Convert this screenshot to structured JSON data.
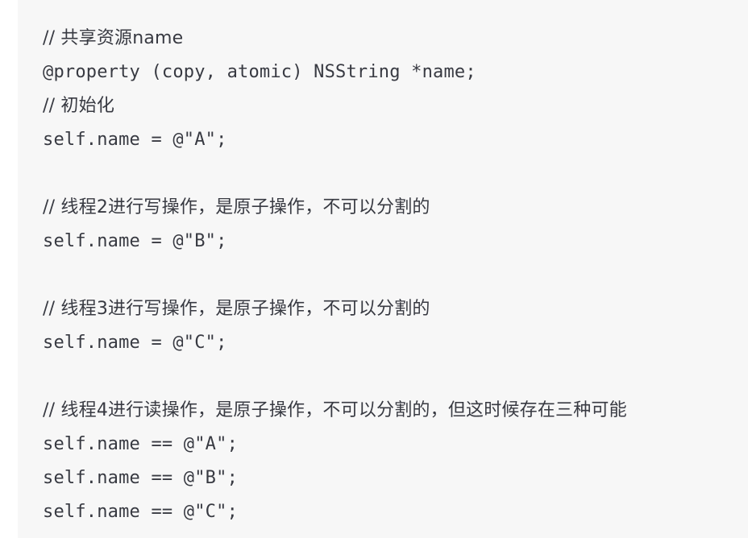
{
  "code": {
    "lines": [
      "// 共享资源name",
      "@property (copy, atomic) NSString *name;",
      "// 初始化",
      "self.name = @\"A\";",
      "",
      "// 线程2进行写操作，是原子操作，不可以分割的",
      "self.name = @\"B\";",
      "",
      "// 线程3进行写操作，是原子操作，不可以分割的",
      "self.name = @\"C\";",
      "",
      "// 线程4进行读操作，是原子操作，不可以分割的，但这时候存在三种可能",
      "self.name == @\"A\";",
      "self.name == @\"B\";",
      "self.name == @\"C\";"
    ]
  }
}
